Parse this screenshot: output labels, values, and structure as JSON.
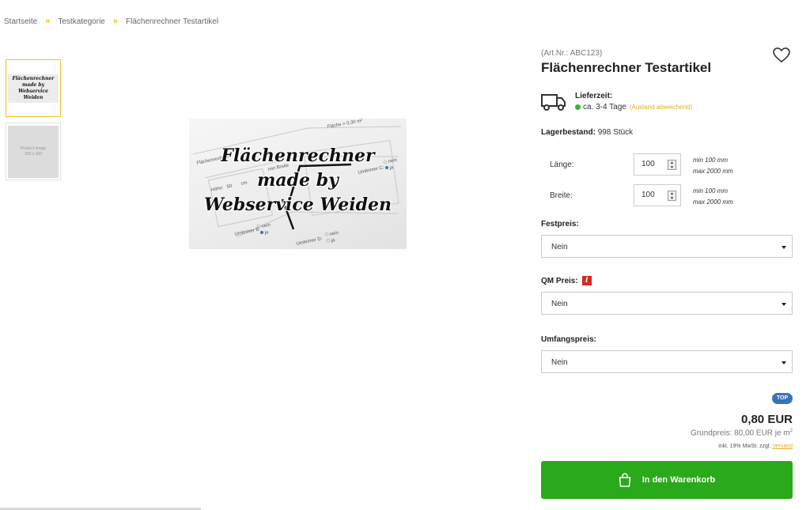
{
  "breadcrumb": {
    "items": [
      "Startseite",
      "Testkategorie",
      "Flächenrechner Testartikel"
    ],
    "separator": "»"
  },
  "gallery": {
    "thumb1_lines": [
      "Flächenrechner",
      "made by",
      "Webservice Weiden"
    ],
    "thumb2_lines": [
      "Product Image",
      "350 x 350"
    ],
    "main_lines": [
      "Flächenrechner",
      "made by",
      "Webservice Weiden"
    ],
    "main_bg_labels": {
      "flaeche": "Fläche = 0,30 m²",
      "flaechenrechner": "Flächenrechner",
      "min_breite": "min Breite",
      "hoehe": "Höhe:",
      "hoehe_val": "50",
      "cm": "cm",
      "umleimer_b": "Umleimer B:",
      "umleimer_c": "Umleimer C:",
      "umleimer_d": "Umleimer D:",
      "nein": "nein",
      "ja": "ja"
    }
  },
  "product": {
    "artnr": "(Art.Nr.: ABC123)",
    "title": "Flächenrechner Testartikel",
    "delivery_label": "Lieferzeit:",
    "delivery_value": "ca. 3-4 Tage",
    "delivery_note": "(Ausland abweichend)",
    "stock_label": "Lagerbestand:",
    "stock_value": "998 Stück"
  },
  "dimensions": [
    {
      "label": "Länge:",
      "value": "100",
      "min": "min 100 mm",
      "max": "max 2000 mm"
    },
    {
      "label": "Breite:",
      "value": "100",
      "min": "min 100 mm",
      "max": "max 2000 mm"
    }
  ],
  "selects": [
    {
      "label": "Festpreis:",
      "value": "Nein",
      "info": false
    },
    {
      "label": "QM Preis:",
      "value": "Nein",
      "info": true,
      "info_glyph": "i"
    },
    {
      "label": "Umfangspreis:",
      "value": "Nein",
      "info": false
    }
  ],
  "pricing": {
    "badge": "TOP",
    "price": "0,80 EUR",
    "base_price": "Grundpreis: 80,00 EUR je m",
    "base_price_sup": "2",
    "vat_text": "inkl. 19% MwSt. zzgl.",
    "vat_link": "Versand"
  },
  "cart": {
    "label": "In den Warenkorb"
  },
  "colors": {
    "accent": "#f0c020",
    "cart_green": "#2aaa1a",
    "badge_blue": "#3a73b8",
    "info_red": "#d9261c",
    "stock_dot": "#3cb043"
  }
}
